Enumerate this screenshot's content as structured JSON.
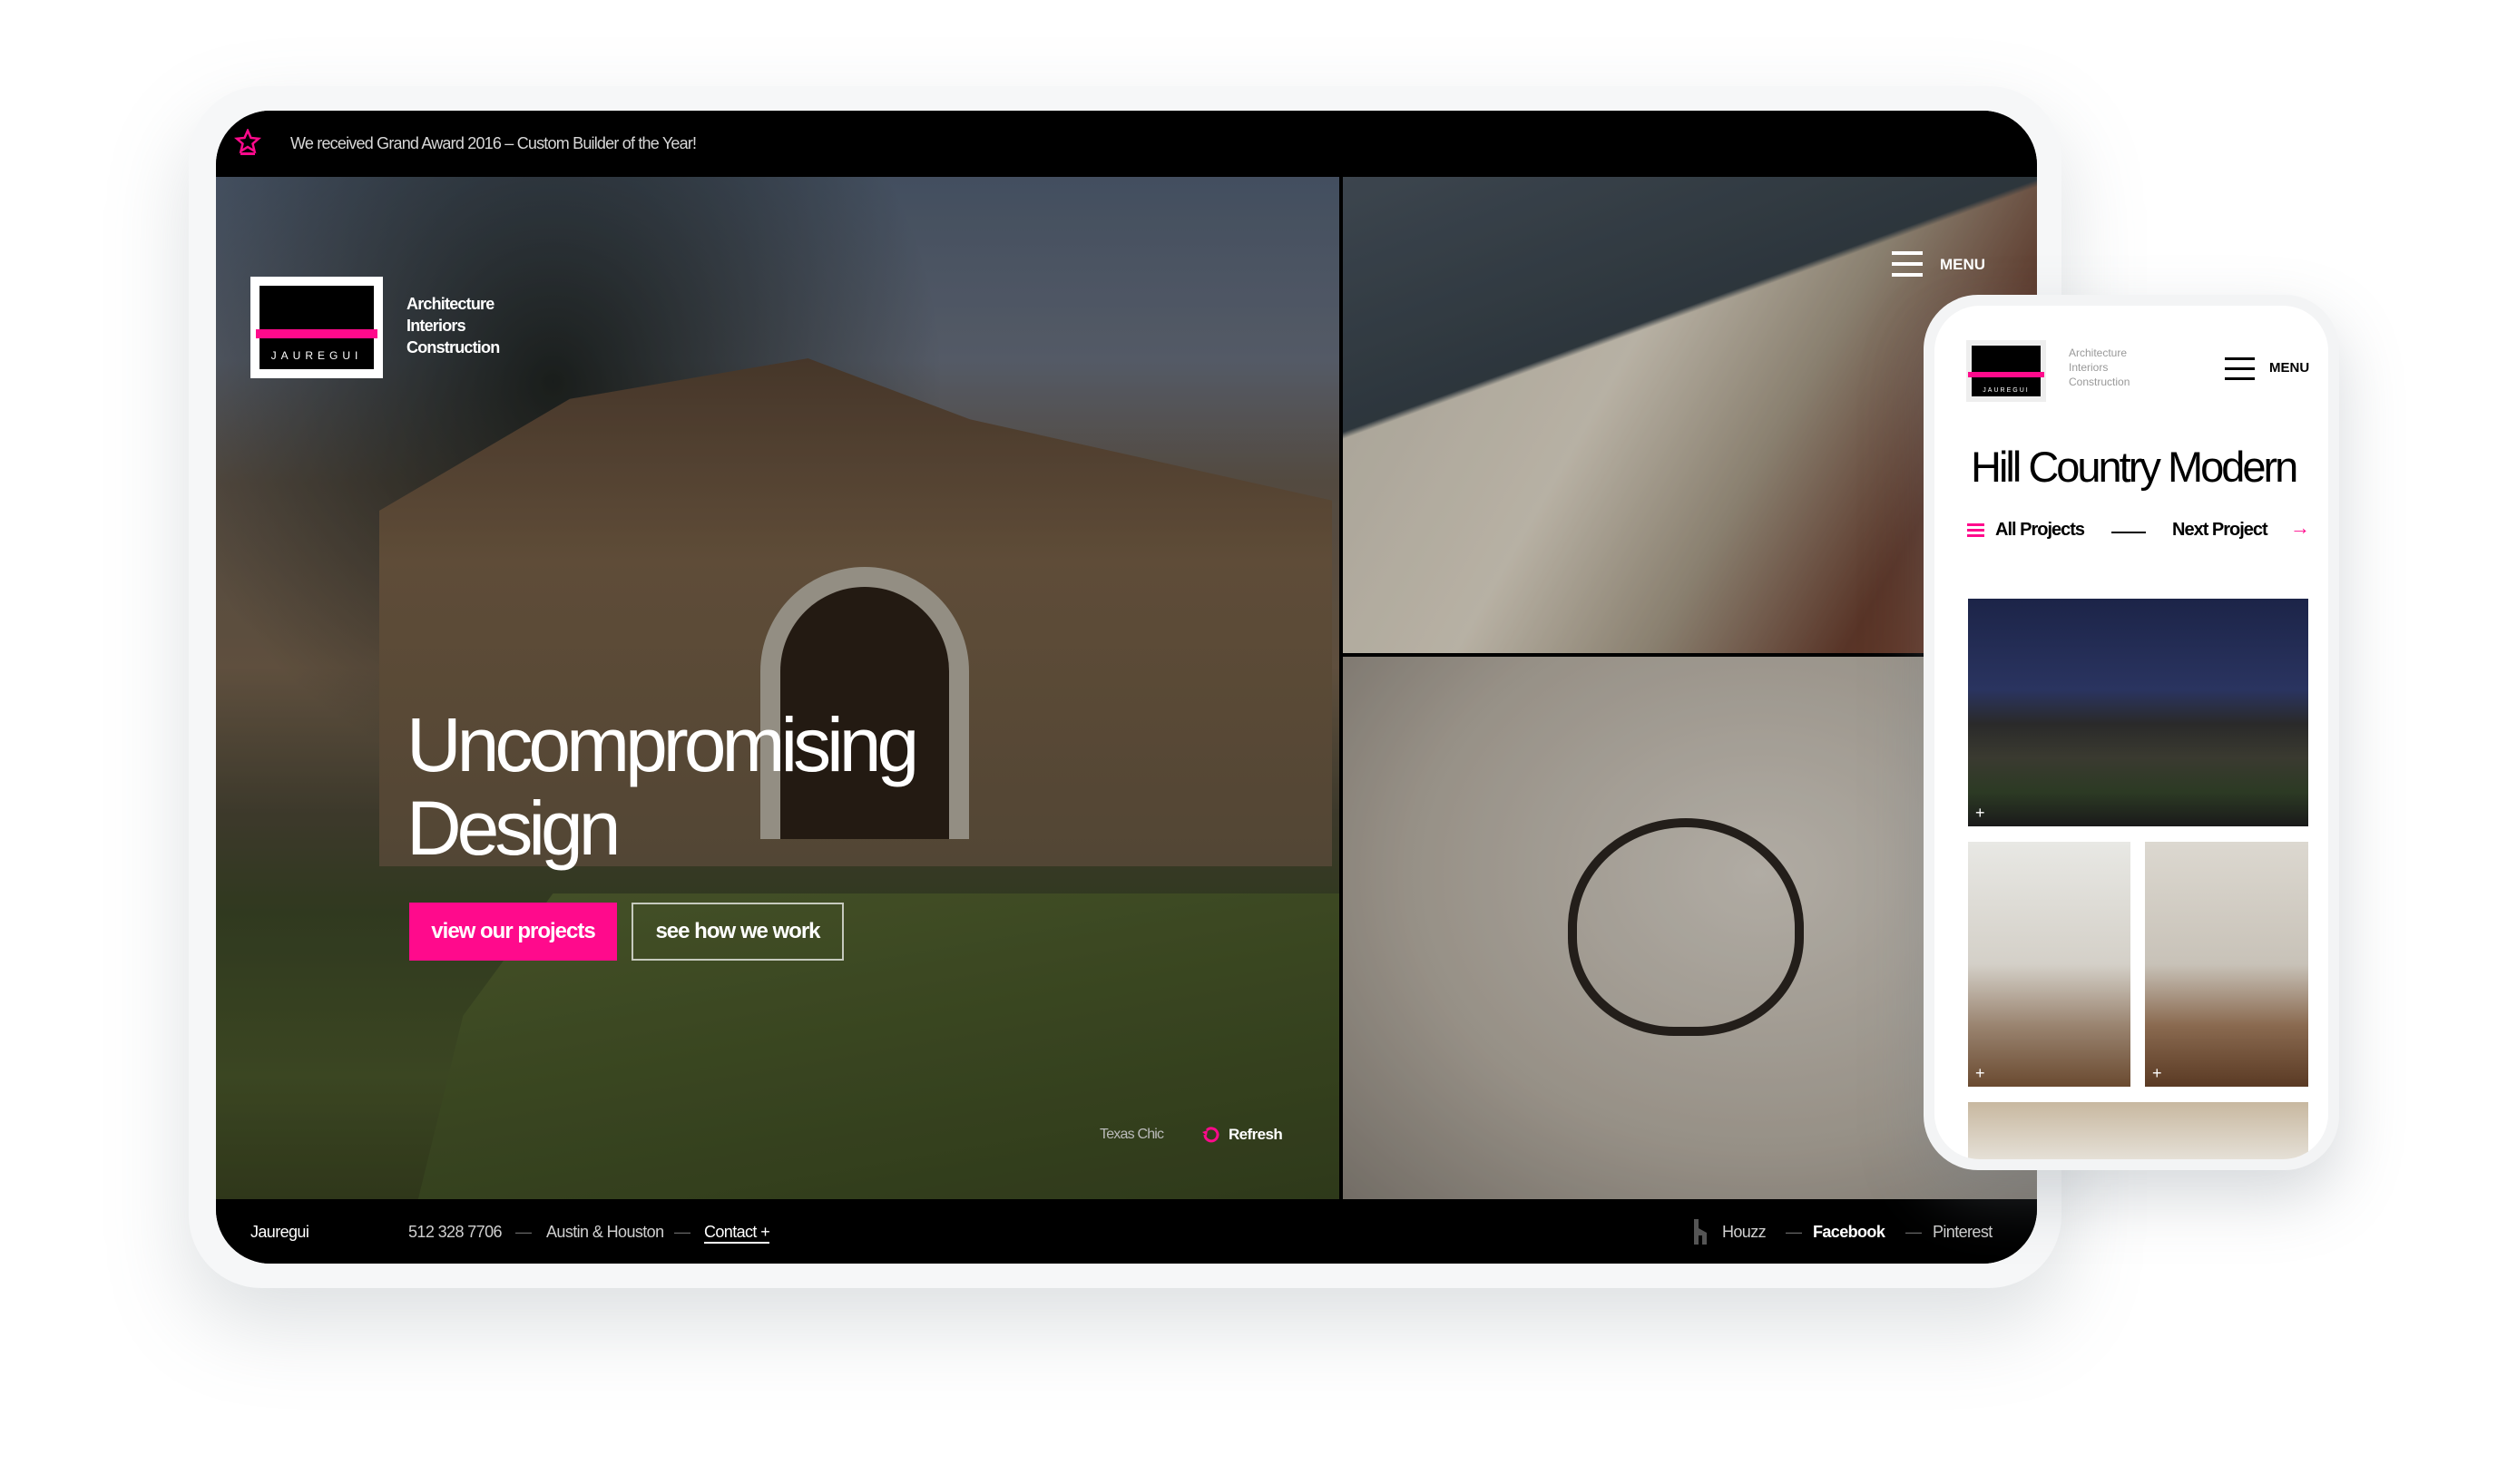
{
  "tablet": {
    "announcement": "We received Grand Award 2016 – Custom Builder of the Year!",
    "announcement_icon": "award-star-icon",
    "logo_text": "JAUREGUI",
    "tagline": [
      "Architecture",
      "Interiors",
      "Construction"
    ],
    "menu_label": "MENU",
    "headline": [
      "Uncompromising",
      "Design"
    ],
    "primary_button": "view our projects",
    "secondary_button": "see how we work",
    "image_caption": "Texas Chic",
    "refresh_label": "Refresh",
    "footer": {
      "brand": "Jauregui",
      "phone": "512 328 7706",
      "locations": "Austin & Houston",
      "contact": "Contact +",
      "social": [
        "Houzz",
        "Facebook",
        "Pinterest"
      ],
      "separator": "—"
    }
  },
  "phone": {
    "logo_text": "JAUREGUI",
    "tagline": [
      "Architecture",
      "Interiors",
      "Construction"
    ],
    "menu_label": "MENU",
    "title": "Hill Country Modern",
    "all_projects": "All Projects",
    "next_project": "Next Project",
    "plus": "+"
  },
  "colors": {
    "accent": "#ff0a8c",
    "dark": "#000000"
  }
}
